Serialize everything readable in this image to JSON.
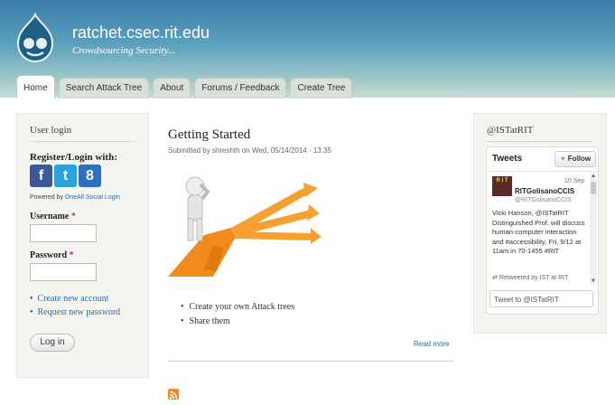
{
  "header": {
    "site_name": "ratchet.csec.rit.edu",
    "slogan": "Crowdsourcing Security..."
  },
  "tabs": [
    {
      "label": "Home",
      "active": true
    },
    {
      "label": "Search Attack Tree"
    },
    {
      "label": "About"
    },
    {
      "label": "Forums / Feedback"
    },
    {
      "label": "Create Tree"
    }
  ],
  "user_login": {
    "title": "User login",
    "register_label": "Register/Login with:",
    "social": [
      {
        "name": "facebook",
        "glyph": "f",
        "color": "#3b5998"
      },
      {
        "name": "twitter",
        "glyph": "t",
        "color": "#2aa3dd"
      },
      {
        "name": "google",
        "glyph": "8",
        "color": "#2e6fc6"
      }
    ],
    "powered_prefix": "Powered by",
    "powered_link": "OneAll Social Login",
    "username_label": "Username",
    "password_label": "Password",
    "required_mark": "*",
    "username_value": "",
    "password_value": "",
    "links": [
      "Create new account",
      "Request new password"
    ],
    "login_button": "Log in"
  },
  "node": {
    "title": "Getting Started",
    "submitted": "Submitted by shreshth on Wed, 05/14/2014 - 13:35",
    "list": [
      "Create your own Attack trees",
      "Share them"
    ],
    "read_more": "Read more"
  },
  "twitter": {
    "block_title": "@ISTatRIT",
    "tweets_label": "Tweets",
    "follow_label": "Follow",
    "tweet": {
      "date": "10 Sep",
      "avatar_text": "R I T",
      "author": "RITGolisanoCCIS",
      "handle": "@RITGolisanoCCIS",
      "text": "Vicki Hanson, @ISTatRIT Distinguished Prof, will discuss human-computer interaction and #accessibility, Fri, 9/12 at 11am in 70-1455 #RIT",
      "retweet": "Retweeted by IST at RIT"
    },
    "tweet_box_placeholder": "Tweet to @ISTatRIT"
  },
  "colors": {
    "link": "#2a6ab0",
    "header_top": "#3a7fa9",
    "rss": "#f78422"
  }
}
